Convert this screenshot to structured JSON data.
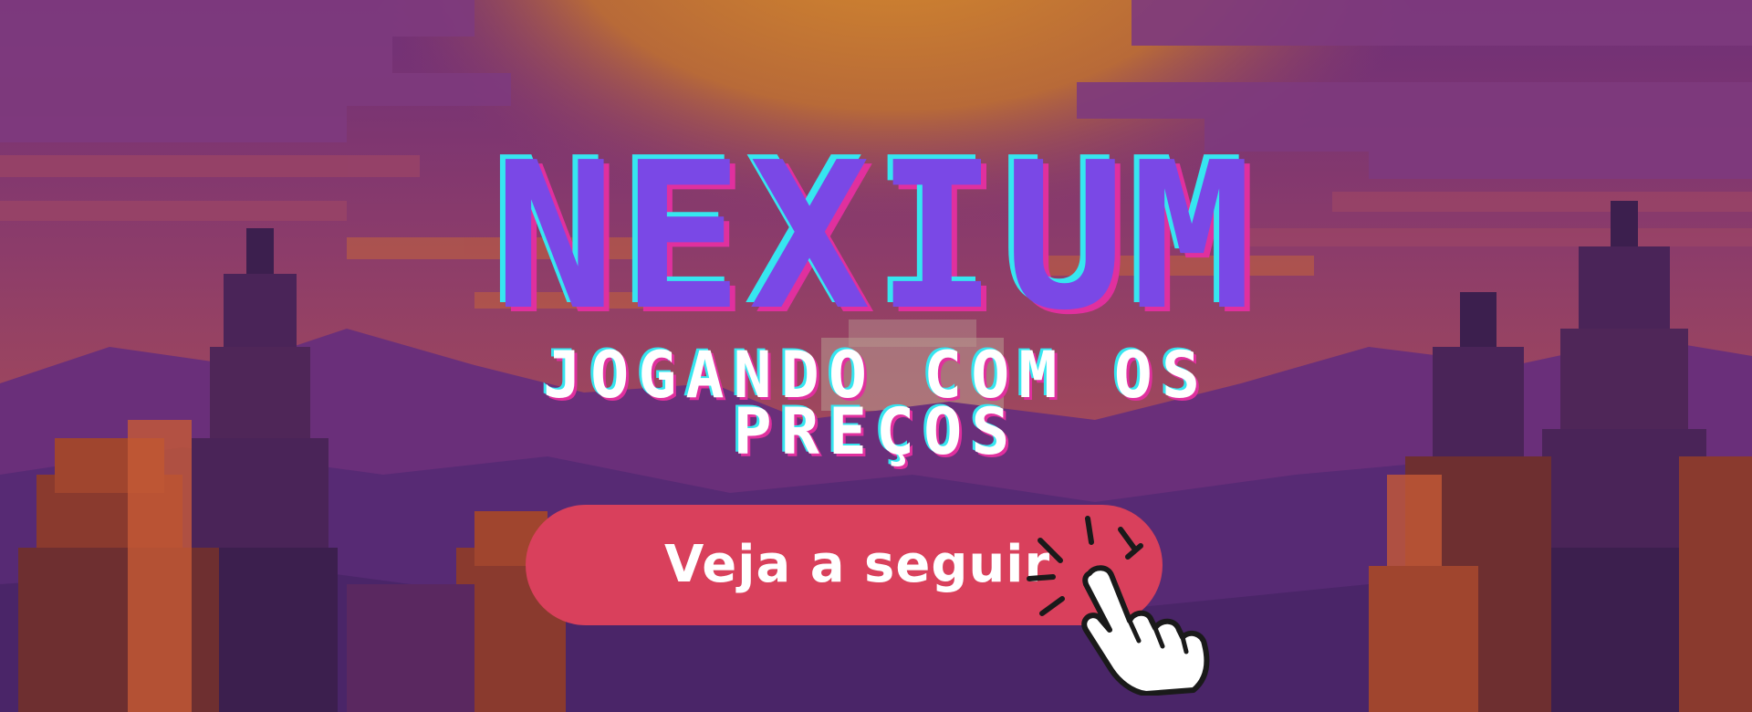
{
  "banner": {
    "title": "NEXIUM",
    "subtitle_line1": "JOGANDO COM OS",
    "subtitle_line2": "PREÇOS",
    "cta_label": "Veja a seguir"
  },
  "colors": {
    "title_fill": "#7a48e6",
    "title_cyan_shadow": "#36e6f0",
    "title_magenta_shadow": "#e0309e",
    "button": "#d9405c",
    "sky_top": "#6b2e76",
    "sun": "#c27a2c"
  },
  "icons": [
    "pointing-hand-icon"
  ]
}
